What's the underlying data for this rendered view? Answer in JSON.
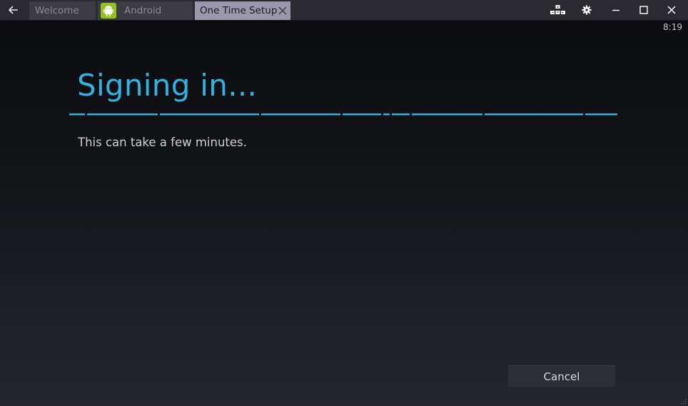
{
  "tabs": [
    {
      "label": "Welcome"
    },
    {
      "label": "Android"
    },
    {
      "label": "One Time Setup"
    }
  ],
  "window_controls": {
    "keys_icon": "keyboard-mapping-icon",
    "settings_icon": "gear-icon",
    "minimize_icon": "minimize-icon",
    "maximize_icon": "maximize-icon",
    "close_icon": "close-icon"
  },
  "status_bar": {
    "time": "8:19"
  },
  "main": {
    "title": "Signing in...",
    "subtitle": "This can take a few minutes.",
    "cancel_label": "Cancel"
  },
  "colors": {
    "accent": "#33b1e0",
    "active_tab": "#9b97ad",
    "android_green": "#94c11f"
  }
}
